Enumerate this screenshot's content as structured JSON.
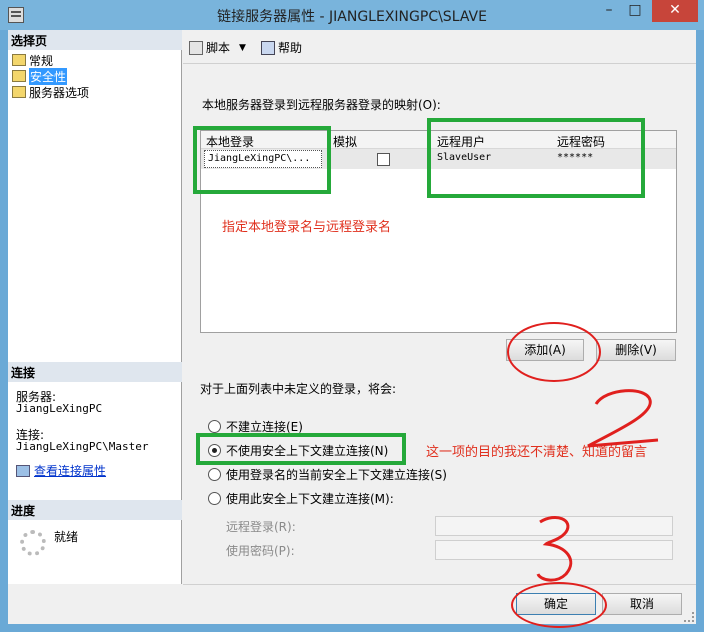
{
  "window": {
    "title": "链接服务器属性 - JIANGLEXINGPC\\SLAVE",
    "minimize": "–",
    "maximize": "□",
    "close": "✕"
  },
  "sidebar": {
    "select_page_header": "选择页",
    "pages": [
      {
        "label": "常规"
      },
      {
        "label": "安全性"
      },
      {
        "label": "服务器选项"
      }
    ],
    "connection_header": "连接",
    "server_label": "服务器:",
    "server_value": "JiangLeXingPC",
    "connection_label": "连接:",
    "connection_value": "JiangLeXingPC\\Master",
    "view_connection_link": "查看连接属性",
    "progress_header": "进度",
    "progress_status": "就绪"
  },
  "toolbar": {
    "script_label": "脚本",
    "help_label": "帮助"
  },
  "mapping": {
    "label": "本地服务器登录到远程服务器登录的映射(O):",
    "columns": [
      "本地登录",
      "模拟",
      "远程用户",
      "远程密码"
    ],
    "rows": [
      {
        "local_login": "JiangLeXingPC\\...",
        "impersonate": false,
        "remote_user": "SlaveUser",
        "remote_password": "******"
      }
    ],
    "add_button": "添加(A)",
    "delete_button": "删除(V)"
  },
  "undefined_logins": {
    "label": "对于上面列表中未定义的登录，将会:",
    "options": [
      {
        "label": "不建立连接(E)",
        "checked": false
      },
      {
        "label": "不使用安全上下文建立连接(N)",
        "checked": true
      },
      {
        "label": "使用登录名的当前安全上下文建立连接(S)",
        "checked": false
      },
      {
        "label": "使用此安全上下文建立连接(M):",
        "checked": false
      }
    ],
    "remote_login_label": "远程登录(R):",
    "password_label": "使用密码(P):"
  },
  "annotations": {
    "note_mapping": "指定本地登录名与远程登录名",
    "note_option": "这一项的目的我还不清楚、知道的留言",
    "marker_2": "2",
    "marker_3": "3",
    "green": "#25a93a",
    "red": "#e0201e"
  },
  "footer": {
    "ok_button": "确定",
    "cancel_button": "取消"
  }
}
